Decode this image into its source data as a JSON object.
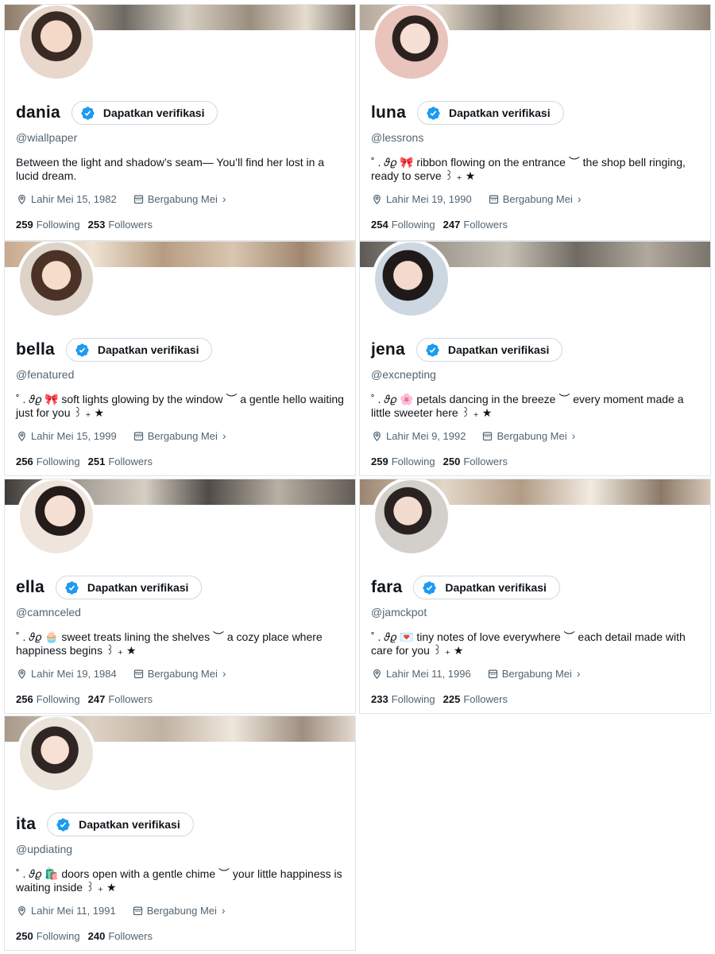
{
  "profiles": [
    {
      "name": "dania",
      "verify_label": "Dapatkan verifikasi",
      "handle": "@wiallpaper",
      "bio": "Between the light and shadow’s seam— You’ll find her lost in a lucid dream.",
      "birth": "Lahir Mei 15, 1982",
      "joined": "Bergabung Mei",
      "following_count": "259",
      "following_label": "Following",
      "followers_count": "253",
      "followers_label": "Followers"
    },
    {
      "name": "luna",
      "verify_label": "Dapatkan verifikasi",
      "handle": "@lessrons",
      "bio": "˚ . 𝜗𝜚 🎀 ribbon flowing on the entrance ︶ the shop bell ringing, ready to serve ꒱ ₊ ★",
      "birth": "Lahir Mei 19, 1990",
      "joined": "Bergabung Mei",
      "following_count": "254",
      "following_label": "Following",
      "followers_count": "247",
      "followers_label": "Followers"
    },
    {
      "name": "bella",
      "verify_label": "Dapatkan verifikasi",
      "handle": "@fenatured",
      "bio": "˚ . 𝜗𝜚 🎀 soft lights glowing by the window ︶ a gentle hello waiting just for you ꒱ ₊ ★",
      "birth": "Lahir Mei 15, 1999",
      "joined": "Bergabung Mei",
      "following_count": "256",
      "following_label": "Following",
      "followers_count": "251",
      "followers_label": "Followers"
    },
    {
      "name": "jena",
      "verify_label": "Dapatkan verifikasi",
      "handle": "@excnepting",
      "bio": "˚ . 𝜗𝜚 🌸 petals dancing in the breeze ︶ every moment made a little sweeter here ꒱ ₊ ★",
      "birth": "Lahir Mei 9, 1992",
      "joined": "Bergabung Mei",
      "following_count": "259",
      "following_label": "Following",
      "followers_count": "250",
      "followers_label": "Followers"
    },
    {
      "name": "ella",
      "verify_label": "Dapatkan verifikasi",
      "handle": "@camnceled",
      "bio": "˚ . 𝜗𝜚 🧁 sweet treats lining the shelves ︶ a cozy place where happiness begins ꒱ ₊ ★",
      "birth": "Lahir Mei 19, 1984",
      "joined": "Bergabung Mei",
      "following_count": "256",
      "following_label": "Following",
      "followers_count": "247",
      "followers_label": "Followers"
    },
    {
      "name": "fara",
      "verify_label": "Dapatkan verifikasi",
      "handle": "@jamckpot",
      "bio": "˚ . 𝜗𝜚 💌 tiny notes of love everywhere ︶ each detail made with care for you ꒱ ₊ ★",
      "birth": "Lahir Mei 11, 1996",
      "joined": "Bergabung Mei",
      "following_count": "233",
      "following_label": "Following",
      "followers_count": "225",
      "followers_label": "Followers"
    },
    {
      "name": "ita",
      "verify_label": "Dapatkan verifikasi",
      "handle": "@updiating",
      "bio": "˚ . 𝜗𝜚 🛍️ doors open with a gentle chime ︶ your little happiness is waiting inside ꒱ ₊ ★",
      "birth": "Lahir Mei 11, 1991",
      "joined": "Bergabung Mei",
      "following_count": "250",
      "following_label": "Following",
      "followers_count": "240",
      "followers_label": "Followers"
    }
  ],
  "colors": {
    "verified_blue": "#1d9bf0",
    "secondary_text": "#536471",
    "primary_text": "#0f1419",
    "border": "#cfd9de"
  },
  "icons": {
    "verify": "verified-badge-icon",
    "birth": "location-pin-icon",
    "joined": "calendar-icon",
    "more": "chevron-right-icon"
  }
}
